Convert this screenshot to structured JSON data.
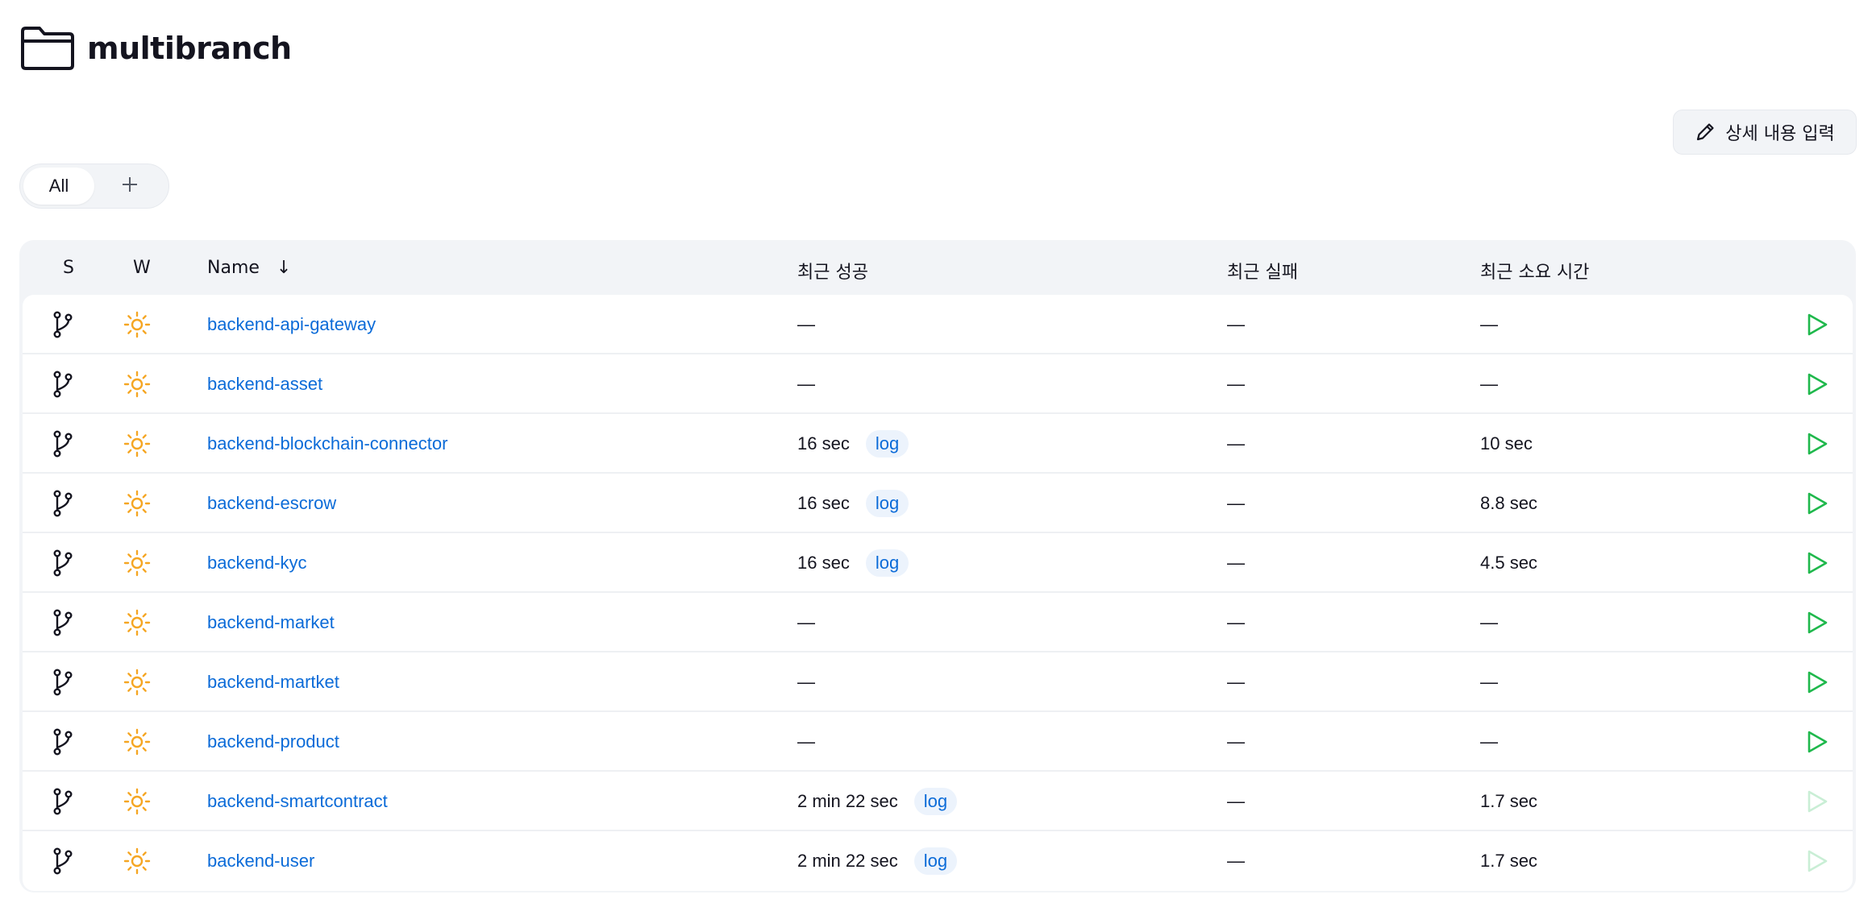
{
  "page": {
    "title": "multibranch",
    "icon": "folder-icon"
  },
  "actions": {
    "edit_description_label": "상세 내용 입력",
    "edit_icon": "pencil-icon"
  },
  "tabs": {
    "all_label": "All",
    "add_icon": "plus-icon"
  },
  "table": {
    "headers": {
      "status": "S",
      "weather": "W",
      "name": "Name",
      "sort_indicator": "↓",
      "last_success": "최근 성공",
      "last_failure": "최근 실패",
      "last_duration": "최근 소요 시간"
    },
    "rows": [
      {
        "name": "backend-api-gateway",
        "last_success": "—",
        "log": "",
        "last_failure": "—",
        "last_duration": "—",
        "run_enabled": true
      },
      {
        "name": "backend-asset",
        "last_success": "—",
        "log": "",
        "last_failure": "—",
        "last_duration": "—",
        "run_enabled": true
      },
      {
        "name": "backend-blockchain-connector",
        "last_success": "16 sec",
        "log": "log",
        "last_failure": "—",
        "last_duration": "10 sec",
        "run_enabled": true
      },
      {
        "name": "backend-escrow",
        "last_success": "16 sec",
        "log": "log",
        "last_failure": "—",
        "last_duration": "8.8 sec",
        "run_enabled": true
      },
      {
        "name": "backend-kyc",
        "last_success": "16 sec",
        "log": "log",
        "last_failure": "—",
        "last_duration": "4.5 sec",
        "run_enabled": true
      },
      {
        "name": "backend-market",
        "last_success": "—",
        "log": "",
        "last_failure": "—",
        "last_duration": "—",
        "run_enabled": true
      },
      {
        "name": "backend-martket",
        "last_success": "—",
        "log": "",
        "last_failure": "—",
        "last_duration": "—",
        "run_enabled": true
      },
      {
        "name": "backend-product",
        "last_success": "—",
        "log": "",
        "last_failure": "—",
        "last_duration": "—",
        "run_enabled": true
      },
      {
        "name": "backend-smartcontract",
        "last_success": "2 min 22 sec",
        "log": "log",
        "last_failure": "—",
        "last_duration": "1.7 sec",
        "run_enabled": false
      },
      {
        "name": "backend-user",
        "last_success": "2 min 22 sec",
        "log": "log",
        "last_failure": "—",
        "last_duration": "1.7 sec",
        "run_enabled": false
      }
    ],
    "icons": {
      "status": "branch-icon",
      "weather": "sun-icon",
      "run": "play-icon"
    }
  },
  "colors": {
    "link": "#0b6bd8",
    "sun": "#f5a623",
    "play_enabled": "#1fb84c",
    "play_disabled": "#c9eed5"
  }
}
